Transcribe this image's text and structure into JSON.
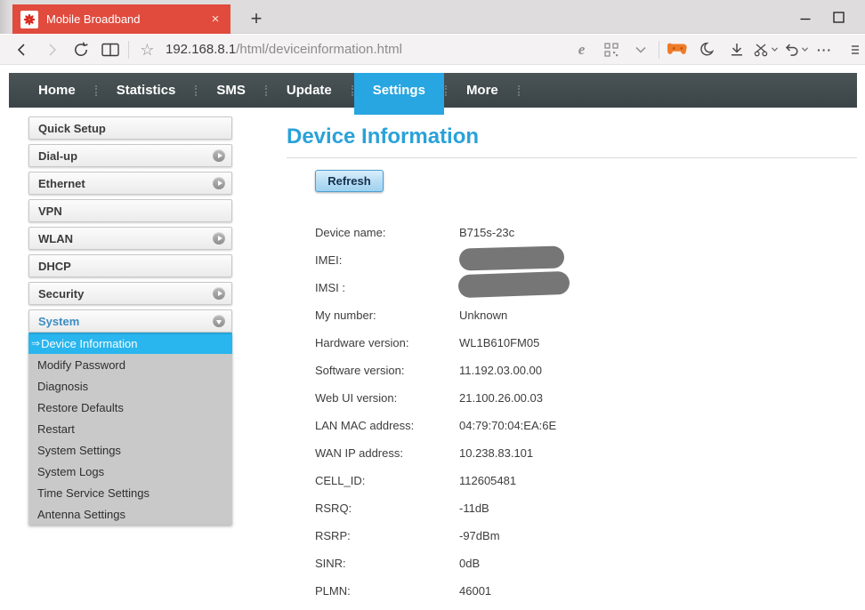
{
  "browser": {
    "tab": {
      "title": "Mobile Broadband",
      "close_glyph": "×"
    },
    "new_tab_glyph": "+",
    "address": {
      "host": "192.168.8.1",
      "path": "/html/deviceinformation.html"
    },
    "star_glyph": "☆",
    "ellipsis_glyph": "···"
  },
  "nav": {
    "items": [
      {
        "label": "Home"
      },
      {
        "label": "Statistics"
      },
      {
        "label": "SMS"
      },
      {
        "label": "Update"
      },
      {
        "label": "Settings",
        "state": "active"
      },
      {
        "label": "More"
      }
    ]
  },
  "sidebar": {
    "items": [
      {
        "label": "Quick Setup"
      },
      {
        "label": "Dial-up",
        "arrow": "right"
      },
      {
        "label": "Ethernet",
        "arrow": "right"
      },
      {
        "label": "VPN"
      },
      {
        "label": "WLAN",
        "arrow": "right"
      },
      {
        "label": "DHCP"
      },
      {
        "label": "Security",
        "arrow": "right"
      },
      {
        "label": "System",
        "arrow": "down",
        "accent": true
      }
    ],
    "selected_arrow_glyph": "⇒",
    "system_submenu": [
      {
        "label": "Device Information",
        "state": "selected"
      },
      {
        "label": "Modify Password"
      },
      {
        "label": "Diagnosis"
      },
      {
        "label": "Restore Defaults"
      },
      {
        "label": "Restart"
      },
      {
        "label": "System Settings"
      },
      {
        "label": "System Logs"
      },
      {
        "label": "Time Service Settings"
      },
      {
        "label": "Antenna Settings"
      }
    ]
  },
  "main": {
    "title": "Device Information",
    "refresh_label": "Refresh",
    "rows": [
      {
        "label": "Device name:",
        "value": "B715s-23c"
      },
      {
        "label": "IMEI:",
        "value": "",
        "redacted": true,
        "redact_style": "width:118px;height:25px;transform:rotate(-1.5deg);top:-2px"
      },
      {
        "label": "IMSI :",
        "value": "",
        "redacted": true,
        "redact_style": "width:125px;height:26px;transform:rotate(-2deg);top:-4px;left:-1px"
      },
      {
        "label": "My number:",
        "value": "Unknown"
      },
      {
        "label": "Hardware version:",
        "value": "WL1B610FM05"
      },
      {
        "label": "Software version:",
        "value": "11.192.03.00.00"
      },
      {
        "label": "Web UI version:",
        "value": "21.100.26.00.03"
      },
      {
        "label": "LAN MAC address:",
        "value": "04:79:70:04:EA:6E"
      },
      {
        "label": "WAN IP address:",
        "value": "10.238.83.101"
      },
      {
        "label": "CELL_ID:",
        "value": "112605481"
      },
      {
        "label": "RSRQ:",
        "value": "-11dB"
      },
      {
        "label": "RSRP:",
        "value": "-97dBm"
      },
      {
        "label": "SINR:",
        "value": "0dB"
      },
      {
        "label": "PLMN:",
        "value": "46001"
      }
    ]
  },
  "colors": {
    "tab_red": "#e04b3e",
    "nav_dark": "#3f494c",
    "nav_active_cyan": "#28a6e1",
    "selected_item_cyan": "#29b5ee",
    "title_blue": "#2aa2d8",
    "redaction_gray": "#767676",
    "gamepad_orange": "#ef7b28"
  }
}
